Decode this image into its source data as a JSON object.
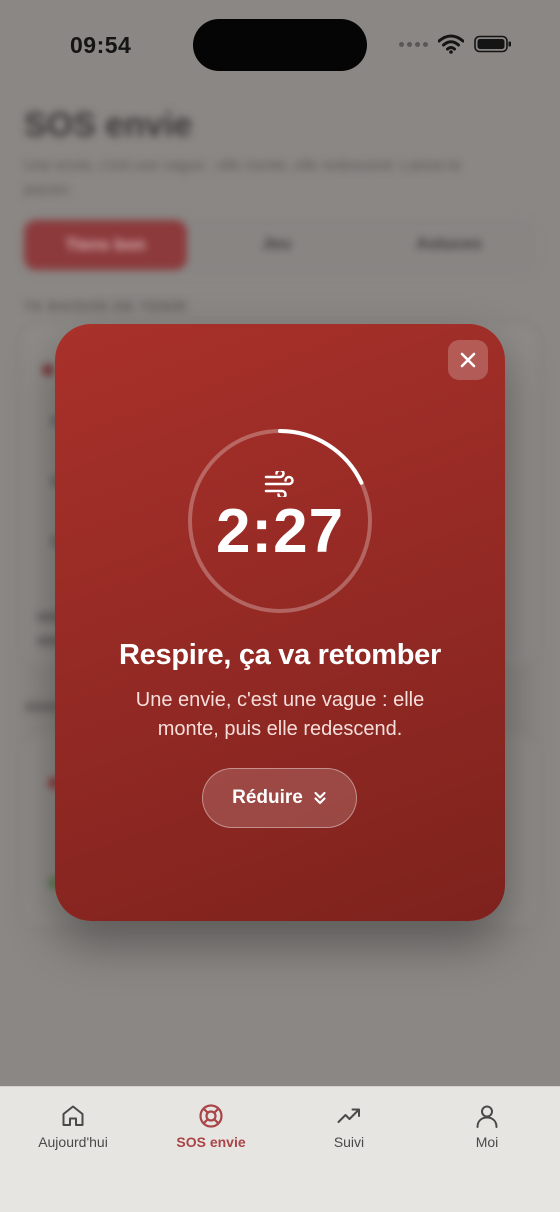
{
  "status_bar": {
    "time": "09:54"
  },
  "background": {
    "title": "SOS envie",
    "subtitle": "Une envie, c'est une vague : elle monte, elle redescend. Laisse-la passer.",
    "segments": [
      "Tiens bon",
      "Jeu",
      "Astuces"
    ],
    "section_label": "TA RAISON DE TENIR"
  },
  "modal": {
    "timer": "2:27",
    "progress_fraction": 0.18,
    "title": "Respire, ça va retomber",
    "body": "Une envie, c'est une vague : elle monte, puis elle redescend.",
    "reduce_label": "Réduire"
  },
  "tabbar": {
    "tabs": [
      {
        "label": "Aujourd'hui",
        "icon": "home-icon",
        "active": false
      },
      {
        "label": "SOS envie",
        "icon": "lifebuoy-icon",
        "active": true
      },
      {
        "label": "Suivi",
        "icon": "trend-up-icon",
        "active": false
      },
      {
        "label": "Moi",
        "icon": "person-icon",
        "active": false
      }
    ]
  },
  "colors": {
    "accent": "#a94447",
    "modal_bg": "#962a25",
    "overlay": "#7a7876",
    "tabbar_bg": "#e7e5e2"
  }
}
